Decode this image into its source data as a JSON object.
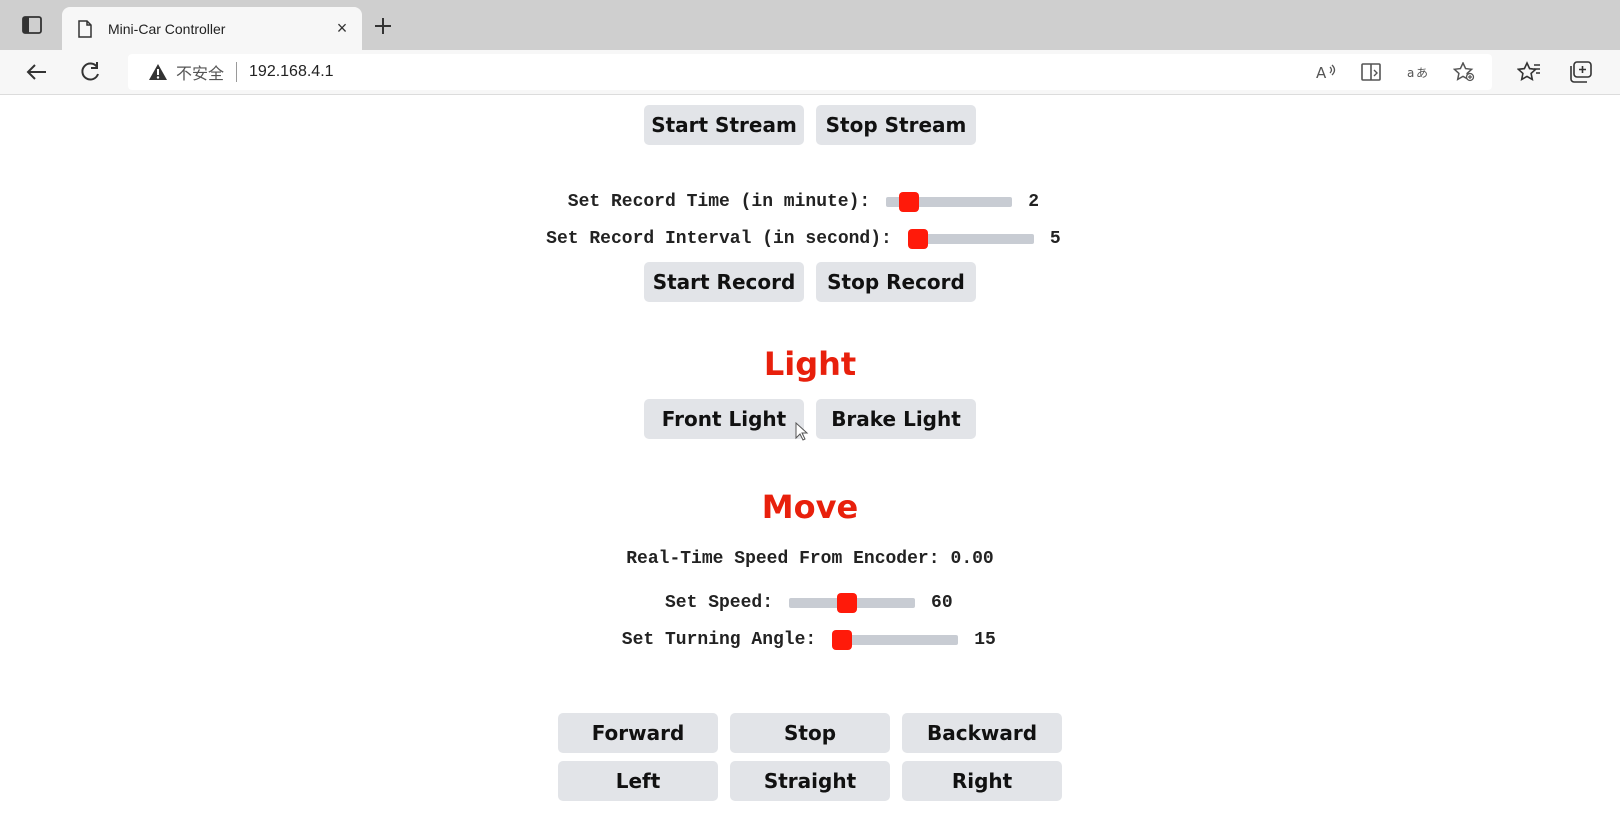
{
  "browser": {
    "tab_title": "Mini-Car Controller",
    "tab_close": "×",
    "new_tab": "+",
    "security_label": "不安全",
    "url": "192.168.4.1"
  },
  "stream": {
    "start_label": "Start Stream",
    "stop_label": "Stop Stream"
  },
  "record": {
    "time_label": "Set Record Time (in minute):",
    "time_value": "2",
    "time_fraction": 0.12,
    "interval_label": "Set Record Interval (in second):",
    "interval_value": "5",
    "interval_fraction": 0.0,
    "start_label": "Start Record",
    "stop_label": "Stop Record"
  },
  "light": {
    "heading": "Light",
    "front_label": "Front Light",
    "brake_label": "Brake Light"
  },
  "move": {
    "heading": "Move",
    "speed_readout_label": "Real-Time Speed From Encoder:",
    "speed_readout_value": "0.00",
    "speed_label": "Set Speed:",
    "speed_value": "60",
    "speed_fraction": 0.45,
    "angle_label": "Set Turning Angle:",
    "angle_value": "15",
    "angle_fraction": 0.0,
    "forward_label": "Forward",
    "stop_label": "Stop",
    "backward_label": "Backward",
    "left_label": "Left",
    "straight_label": "Straight",
    "right_label": "Right"
  },
  "colors": {
    "accent": "#e8200c",
    "slider_thumb": "#ff1a0a",
    "button_bg": "#e2e4e8"
  }
}
